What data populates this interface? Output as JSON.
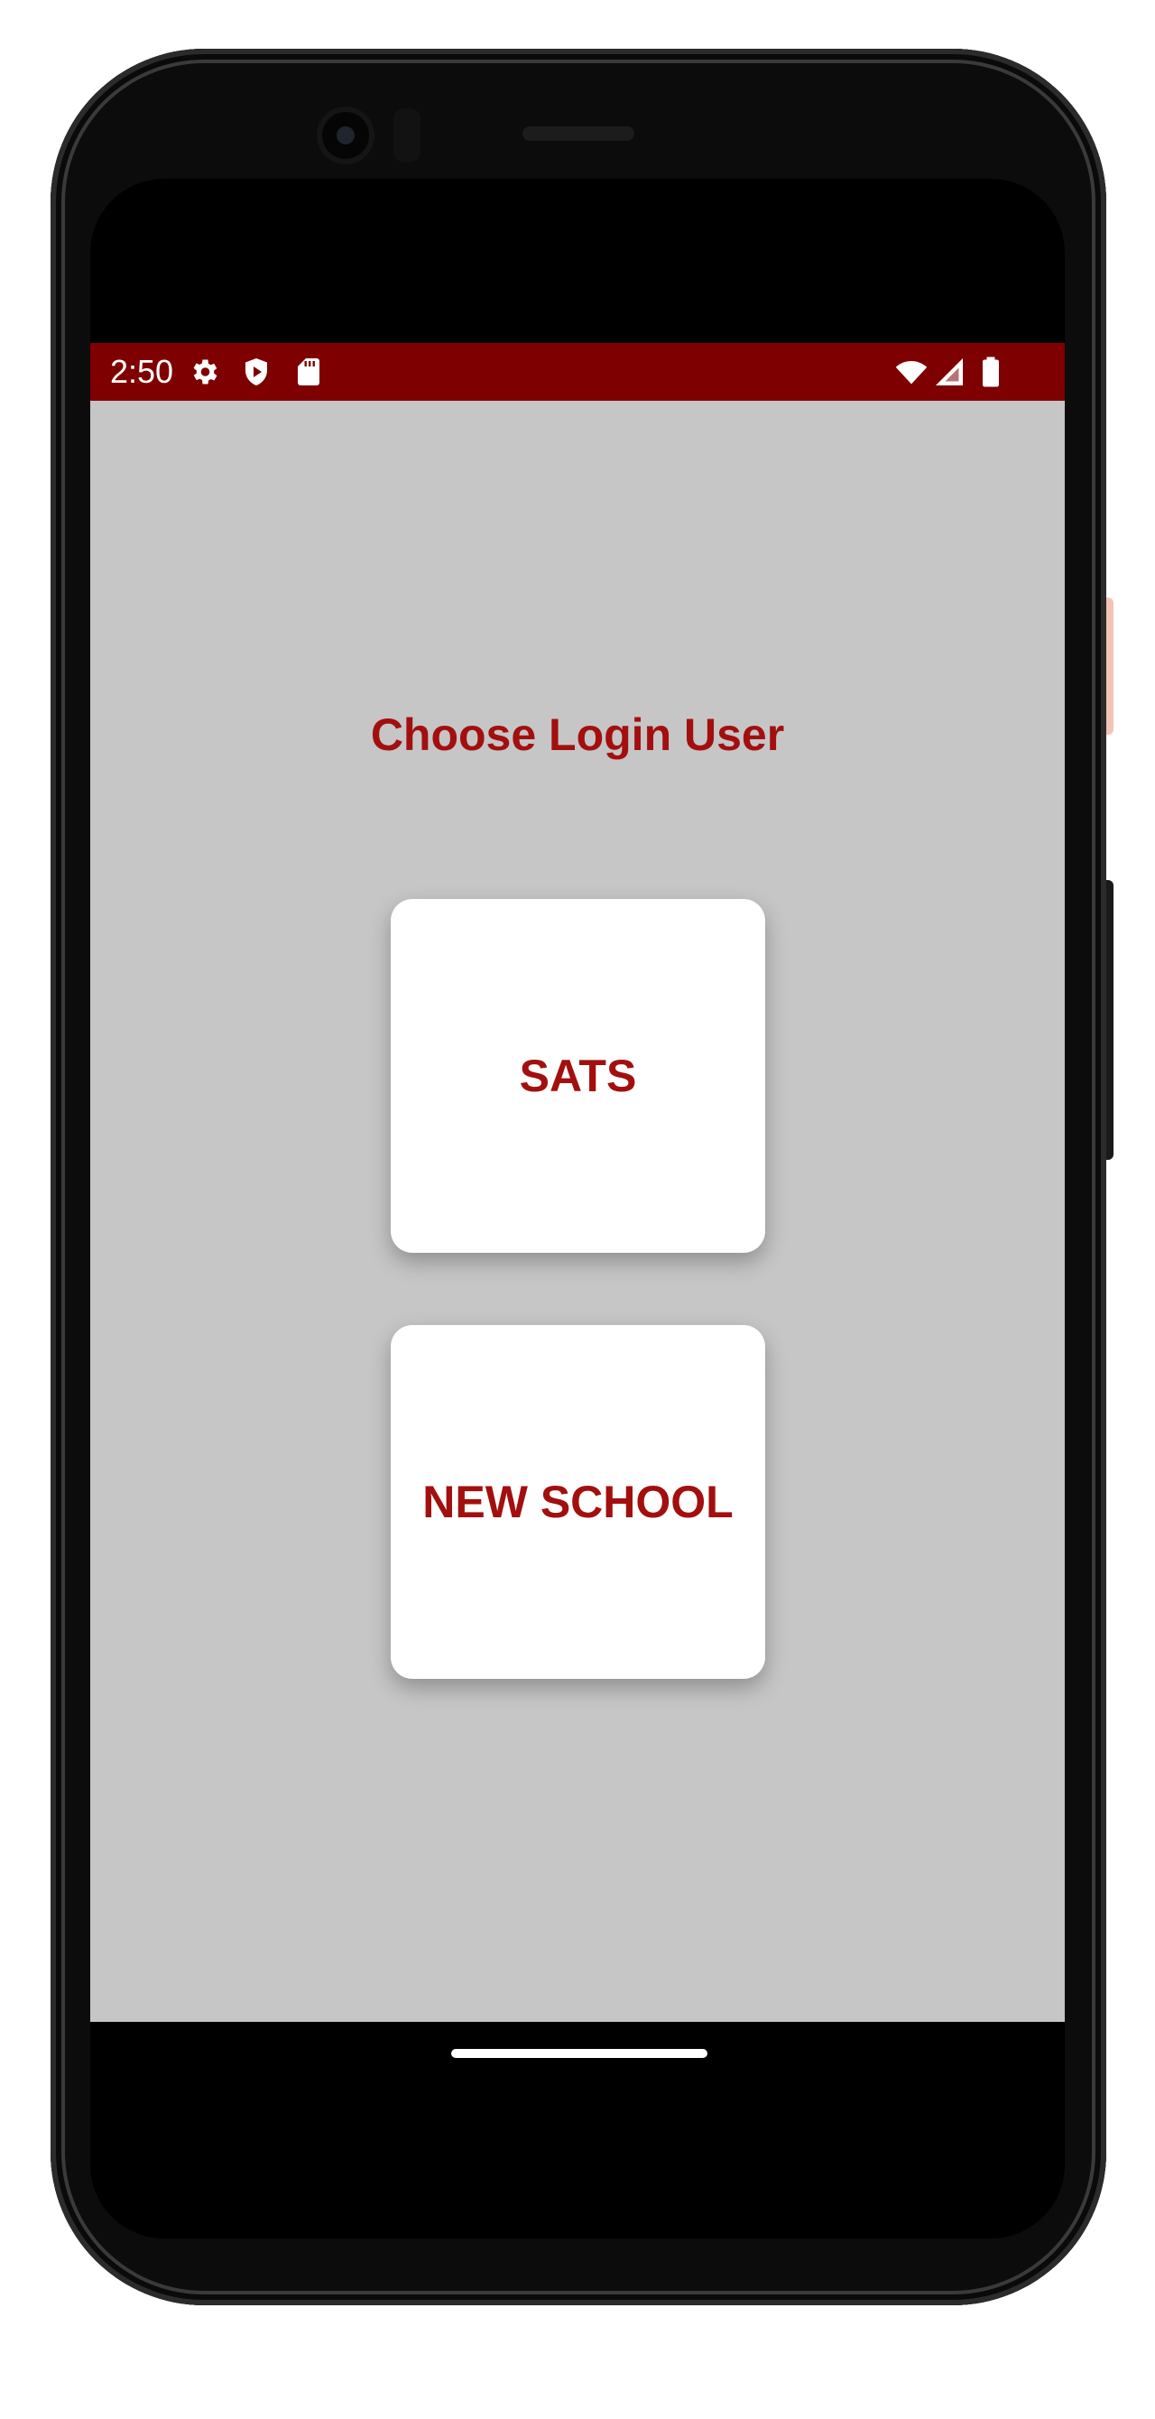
{
  "status_bar": {
    "time": "2:50",
    "left_icons": [
      "gear-icon",
      "shield-play-icon",
      "sd-card-icon"
    ],
    "right_icons": [
      "wifi-icon",
      "signal-icon",
      "battery-icon"
    ],
    "background_color": "#7f0000"
  },
  "screen": {
    "title": "Choose Login User",
    "options": [
      {
        "label": "SATS"
      },
      {
        "label": "NEW SCHOOL"
      }
    ],
    "accent_color": "#a30f0f",
    "background_color": "#c6c6c6"
  }
}
